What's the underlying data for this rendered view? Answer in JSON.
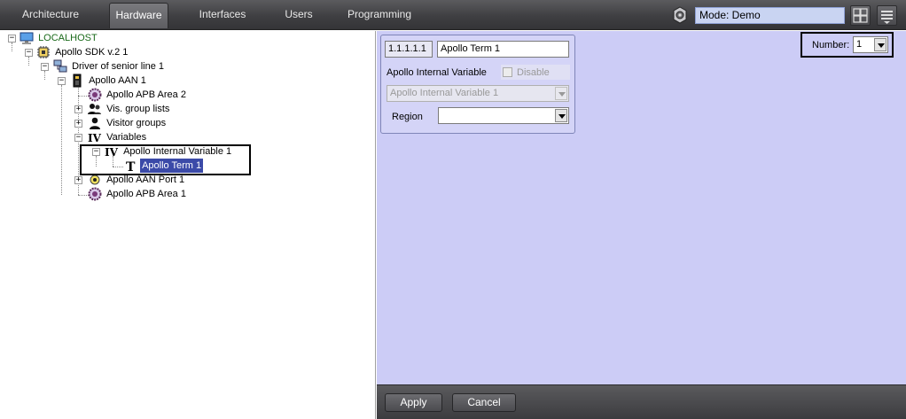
{
  "topbar": {
    "tabs": [
      {
        "label": "Architecture",
        "active": false
      },
      {
        "label": "Hardware",
        "active": true
      },
      {
        "label": "Interfaces",
        "active": false
      },
      {
        "label": "Users",
        "active": false
      },
      {
        "label": "Programming",
        "active": false
      }
    ],
    "mode": "Mode: Demo",
    "icons": [
      "gear-icon",
      "layout-grid-icon",
      "menu-icon"
    ]
  },
  "tree": {
    "root": "LOCALHOST",
    "sdk": "Apollo SDK v.2 1",
    "driver": "Driver of senior line 1",
    "aan": "Apollo AAN 1",
    "apb_area_2": "Apollo APB Area 2",
    "vis_groups": "Vis. group lists",
    "visitor_groups": "Visitor groups",
    "variables": "Variables",
    "internal_var": "Apollo Internal Variable 1",
    "term": "Apollo Term 1",
    "aan_port": "Apollo AAN Port 1",
    "apb_area_1": "Apollo APB Area 1"
  },
  "settings": {
    "id": "1.1.1.1.1",
    "name": "Apollo Term 1",
    "internal_var_label": "Apollo Internal Variable",
    "disable_label": "Disable",
    "internal_var_value": "Apollo Internal Variable 1",
    "region_label": "Region",
    "region_value": ""
  },
  "number": {
    "label": "Number:",
    "value": "1"
  },
  "bottom": {
    "apply": "Apply",
    "cancel": "Cancel"
  },
  "colors": {
    "topbar": "#3f3f42",
    "panel": "#ccccf6",
    "selection": "#3b4aa8",
    "mode_field": "#c9d4f2"
  }
}
